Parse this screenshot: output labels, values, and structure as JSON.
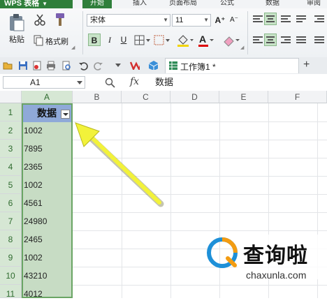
{
  "app": {
    "menu_label": "WPS 表格"
  },
  "ribbon_tabs": [
    "开始",
    "插入",
    "页面布局",
    "公式",
    "数据",
    "审阅"
  ],
  "ribbon": {
    "paste_label": "粘贴",
    "cut_label": "",
    "format_painter_label": "格式刷",
    "font_name": "宋体",
    "font_size": "11",
    "bold": "B",
    "italic": "I",
    "underline": "U",
    "font_color_glyph": "A",
    "font_grow": "A⁺",
    "font_shrink": "A⁻"
  },
  "document_tab": {
    "title": "工作簿1 *"
  },
  "formula_bar": {
    "cell_ref": "A1",
    "fx": "fx",
    "content": "数据"
  },
  "columns": [
    "A",
    "B",
    "C",
    "D",
    "E",
    "F"
  ],
  "rows": [
    "1",
    "2",
    "3",
    "4",
    "5",
    "6",
    "7",
    "8",
    "9",
    "10",
    "11"
  ],
  "cells_A": [
    "数据",
    "1002",
    "7895",
    "2365",
    "1002",
    "4561",
    "24980",
    "2465",
    "1002",
    "43210",
    "4012"
  ],
  "watermark": {
    "brand": "查询啦",
    "domain": "chaxunla.com"
  },
  "colors": {
    "accent_green": "#2f7f3a",
    "header_cell_blue": "#8fa9d8",
    "selection_green": "#c7dcc4",
    "arrow_yellow": "#f2f23a"
  }
}
